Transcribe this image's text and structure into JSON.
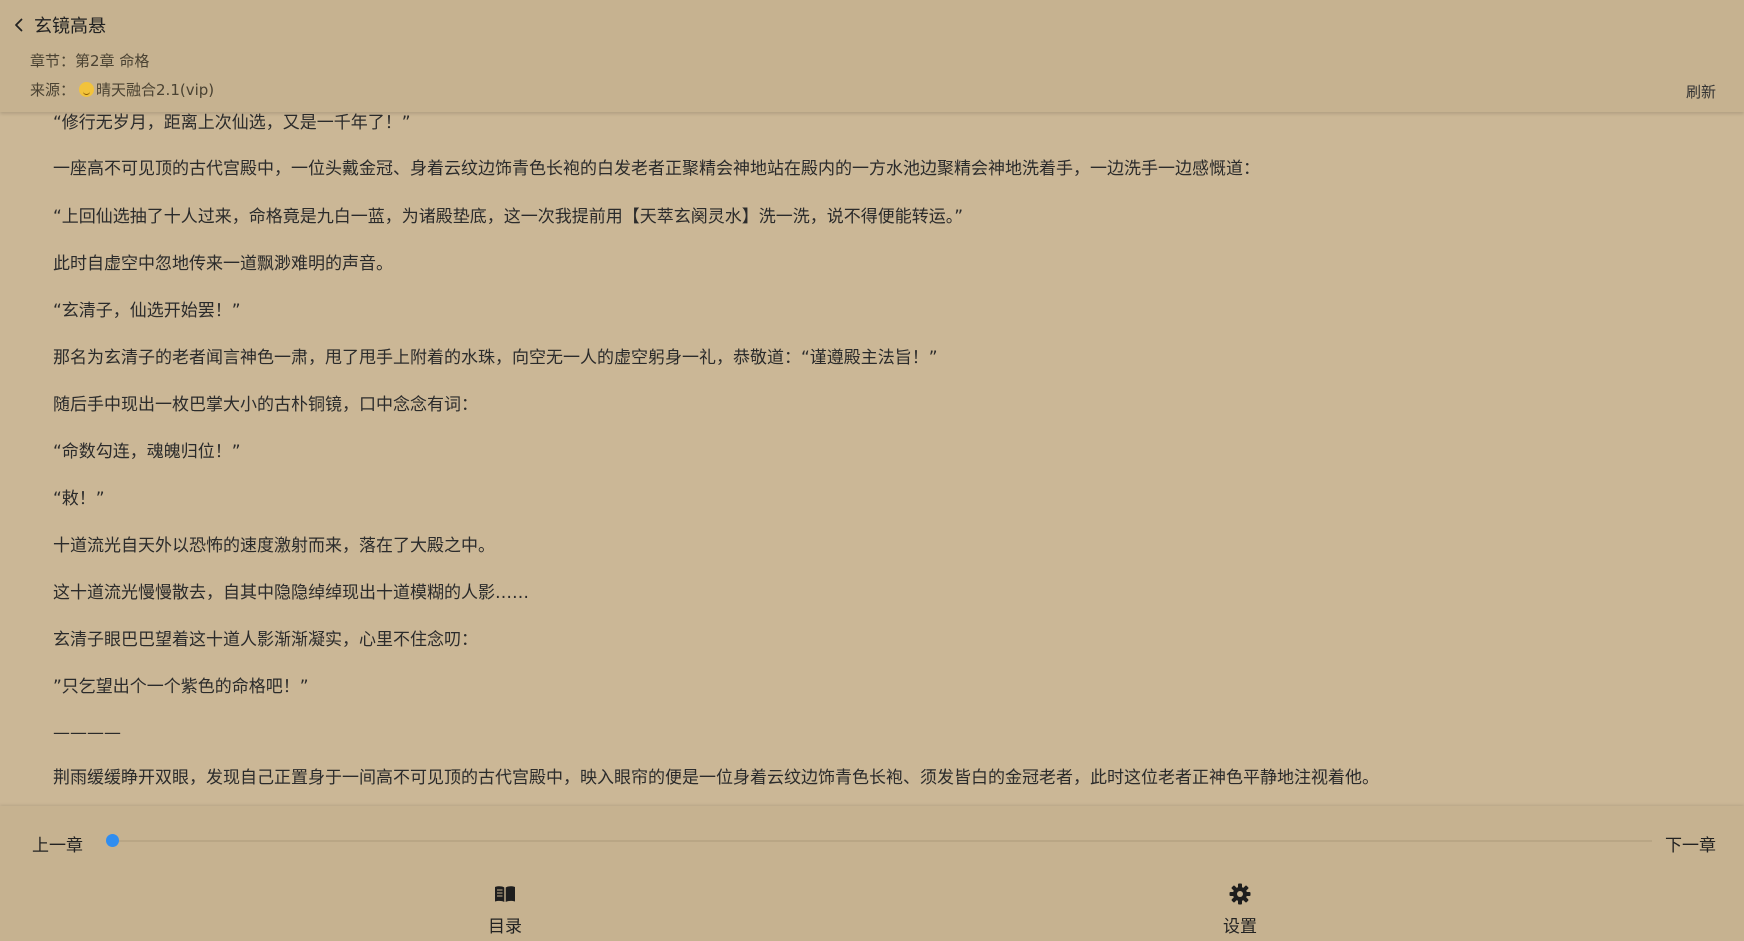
{
  "header": {
    "book_title": "玄镜高悬",
    "chapter_label": "章节：",
    "chapter_name": "第2章 命格",
    "source_label": "来源：",
    "source_name": "晴天融合2.1(vip)",
    "refresh_label": "刷新"
  },
  "content": {
    "paragraphs": [
      "“修行无岁月，距离上次仙选，又是一千年了！”",
      "一座高不可见顶的古代宫殿中，一位头戴金冠、身着云纹边饰青色长袍的白发老者正聚精会神地站在殿内的一方水池边聚精会神地洗着手，一边洗手一边感慨道：",
      "“上回仙选抽了十人过来，命格竟是九白一蓝，为诸殿垫底，这一次我提前用【天萃玄阕灵水】洗一洗，说不得便能转运。”",
      "此时自虚空中忽地传来一道飘渺难明的声音。",
      "“玄清子，仙选开始罢！”",
      "那名为玄清子的老者闻言神色一肃，甩了甩手上附着的水珠，向空无一人的虚空躬身一礼，恭敬道：“谨遵殿主法旨！”",
      "随后手中现出一枚巴掌大小的古朴铜镜，口中念念有词：",
      "“命数勾连，魂魄归位！”",
      "“敕！”",
      "十道流光自天外以恐怖的速度激射而来，落在了大殿之中。",
      "这十道流光慢慢散去，自其中隐隐绰绰现出十道模糊的人影……",
      "玄清子眼巴巴望着这十道人影渐渐凝实，心里不住念叨：",
      "”只乞望出个一个紫色的命格吧！”",
      "————",
      "荆雨缓缓睁开双眼，发现自己正置身于一间高不可见顶的古代宫殿中，映入眼帘的便是一位身着云纹边饰青色长袍、须发皆白的金冠老者，此时这位老者正神色平静地注视着他。"
    ]
  },
  "bottom": {
    "prev_label": "上一章",
    "next_label": "下一章",
    "progress": 0.0,
    "toc_label": "目录",
    "settings_label": "设置",
    "toc_icon": "book-open-icon",
    "settings_icon": "gear-icon"
  },
  "colors": {
    "background": "#cbb796",
    "bar_background": "#c6b290",
    "accent": "#2f8df0"
  }
}
